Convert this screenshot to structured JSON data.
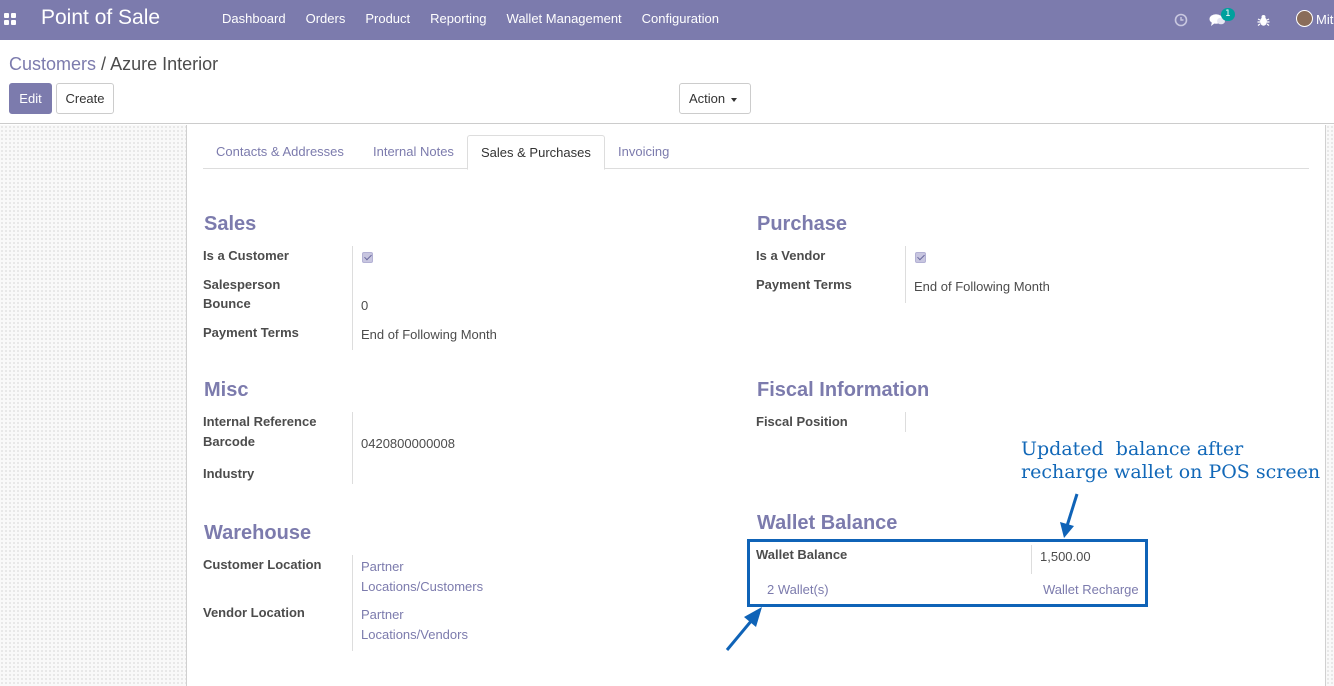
{
  "app": {
    "title": "Point of Sale",
    "menu": [
      "Dashboard",
      "Orders",
      "Product",
      "Reporting",
      "Wallet Management",
      "Configuration"
    ],
    "chat_count": "1",
    "user_name_partial": "Mit"
  },
  "breadcrumb": {
    "parent": "Customers",
    "separator": "/",
    "current": "Azure Interior"
  },
  "buttons": {
    "edit": "Edit",
    "create": "Create",
    "action": "Action"
  },
  "tabs": [
    "Contacts & Addresses",
    "Internal Notes",
    "Sales & Purchases",
    "Invoicing"
  ],
  "active_tab": "Sales & Purchases",
  "sales": {
    "title": "Sales",
    "is_customer_label": "Is a Customer",
    "is_customer": true,
    "salesperson_label": "Salesperson",
    "bounce_label": "Bounce",
    "bounce_value": "0",
    "payment_terms_label": "Payment Terms",
    "payment_terms_value": "End of Following Month"
  },
  "purchase": {
    "title": "Purchase",
    "is_vendor_label": "Is a Vendor",
    "is_vendor": true,
    "payment_terms_label": "Payment Terms",
    "payment_terms_value": "End of Following Month"
  },
  "misc": {
    "title": "Misc",
    "internal_ref_label": "Internal Reference",
    "barcode_label": "Barcode",
    "barcode_value": "0420800000008",
    "industry_label": "Industry"
  },
  "fiscal": {
    "title": "Fiscal Information",
    "fiscal_position_label": "Fiscal Position"
  },
  "warehouse": {
    "title": "Warehouse",
    "customer_location_label": "Customer Location",
    "customer_location_line1": "Partner",
    "customer_location_line2": "Locations/Customers",
    "vendor_location_label": "Vendor Location",
    "vendor_location_line1": "Partner",
    "vendor_location_line2": "Locations/Vendors"
  },
  "wallet": {
    "title": "Wallet Balance",
    "balance_label": "Wallet Balance",
    "balance_value": "1,500.00",
    "wallets_link": "2 Wallet(s)",
    "recharge_link": "Wallet Recharge"
  },
  "annotation": {
    "line1": "Updated  balance after",
    "line2": "recharge wallet on POS screen",
    "color": "#1268b8"
  },
  "colors": {
    "brand": "#7c7bad",
    "highlight": "#0f63b7"
  }
}
